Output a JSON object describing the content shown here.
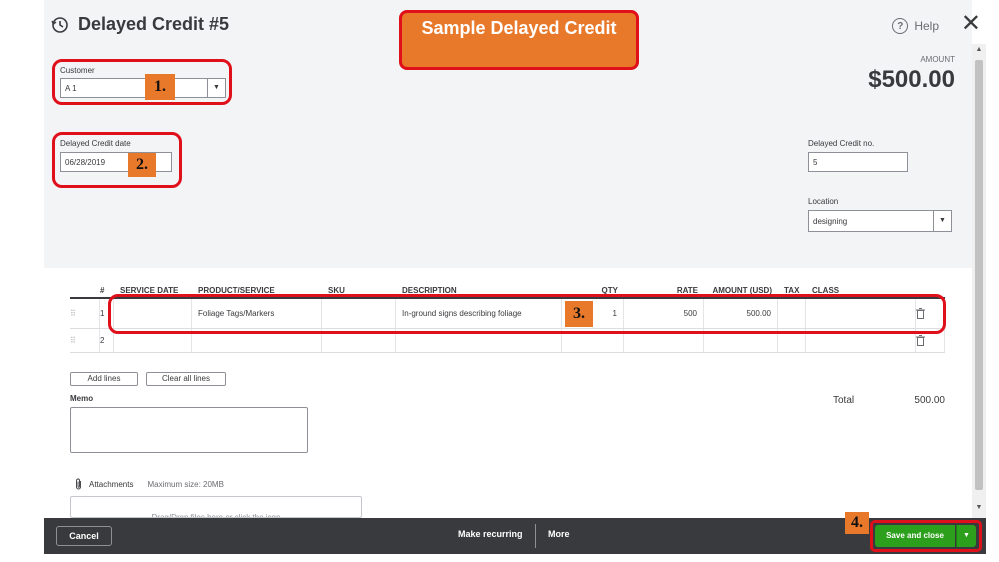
{
  "header": {
    "title": "Delayed Credit #5",
    "help_label": "Help",
    "close_glyph": "✕",
    "history_icon": "history-icon"
  },
  "callout": {
    "text": "Sample Delayed Credit"
  },
  "steps": [
    "1.",
    "2.",
    "3.",
    "4."
  ],
  "customer": {
    "label": "Customer",
    "value": "A 1"
  },
  "credit_date": {
    "label": "Delayed Credit date",
    "value": "06/28/2019"
  },
  "amount": {
    "label": "AMOUNT",
    "value": "$500.00"
  },
  "credit_no": {
    "label": "Delayed Credit no.",
    "value": "5"
  },
  "location": {
    "label": "Location",
    "value": "designing"
  },
  "table": {
    "headers": {
      "num": "#",
      "date": "SERVICE DATE",
      "prod": "PRODUCT/SERVICE",
      "sku": "SKU",
      "desc": "DESCRIPTION",
      "qty": "QTY",
      "rate": "RATE",
      "amt": "AMOUNT (USD)",
      "tax": "TAX",
      "class": "CLASS"
    },
    "rows": [
      {
        "num": "1",
        "date": "",
        "prod": "Foliage Tags/Markers",
        "sku": "",
        "desc": "In-ground signs describing foliage",
        "qty": "1",
        "rate": "500",
        "amt": "500.00",
        "tax": "",
        "class": ""
      },
      {
        "num": "2",
        "date": "",
        "prod": "",
        "sku": "",
        "desc": "",
        "qty": "",
        "rate": "",
        "amt": "",
        "tax": "",
        "class": ""
      }
    ]
  },
  "actions": {
    "add_lines": "Add lines",
    "clear_lines": "Clear all lines"
  },
  "memo": {
    "label": "Memo"
  },
  "totals": {
    "label": "Total",
    "value": "500.00"
  },
  "attachments": {
    "label": "Attachments",
    "max_size": "Maximum size: 20MB",
    "drop_hint": "Drag/Drop files here or click the icon"
  },
  "footer": {
    "cancel": "Cancel",
    "make_recurring": "Make recurring",
    "more": "More",
    "save_close": "Save and close"
  },
  "colors": {
    "accent_green": "#2ca01c",
    "highlight_red": "#e0101a",
    "callout_orange": "#e8782a",
    "footer_bg": "#393a3d"
  }
}
